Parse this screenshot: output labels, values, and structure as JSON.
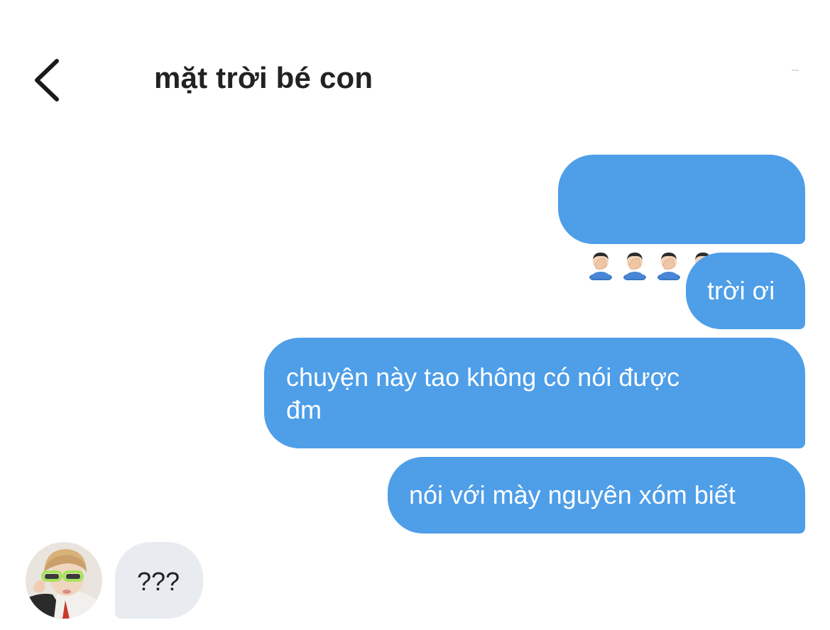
{
  "header": {
    "back_icon": "chevron-left-icon",
    "title": "mặt trời bé con"
  },
  "conversation": {
    "outgoing_color": "#4e9ee8",
    "incoming_color": "#e8ecf0",
    "messages": [
      {
        "direction": "outgoing",
        "emoji": "facepalm",
        "emoji_count": 6
      },
      {
        "direction": "outgoing",
        "text": "trời ơi"
      },
      {
        "direction": "outgoing",
        "text": "chuyện này tao không có nói được\nđm"
      },
      {
        "direction": "outgoing",
        "text": "nói với mày nguyên xóm biết"
      },
      {
        "direction": "incoming",
        "text": "???",
        "avatar_icon": "contact-avatar"
      }
    ]
  }
}
